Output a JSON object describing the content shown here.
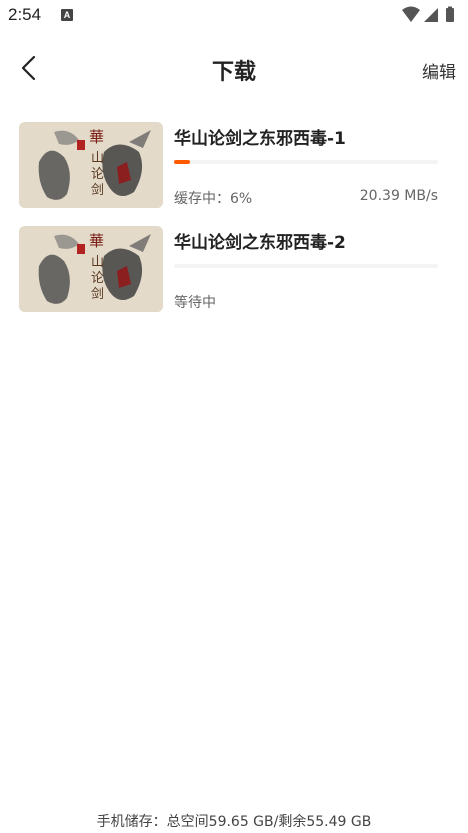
{
  "status_bar": {
    "time": "2:54",
    "notification_letter": "A"
  },
  "header": {
    "title": "下载",
    "edit_label": "编辑"
  },
  "downloads": [
    {
      "title": "华山论剑之东邪西毒-1",
      "status": "缓存中：6%",
      "speed": "20.39 MB/s",
      "progress": 0.06
    },
    {
      "title": "华山论剑之东邪西毒-2",
      "status": "等待中",
      "speed": "",
      "progress": 0
    }
  ],
  "footer": {
    "storage": "手机储存：总空间59.65 GB/剩余55.49 GB"
  },
  "colors": {
    "accent": "#ff5a00",
    "track": "#f4f4f4"
  }
}
